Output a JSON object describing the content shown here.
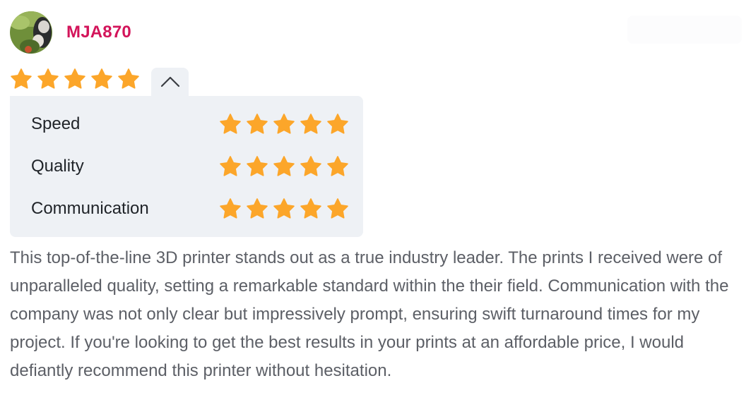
{
  "review": {
    "author": "MJA870",
    "rating": 5,
    "rating_max": 5,
    "breakdown": [
      {
        "label": "Speed",
        "rating": 5
      },
      {
        "label": "Quality",
        "rating": 5
      },
      {
        "label": "Communication",
        "rating": 5
      }
    ],
    "text": "This top-of-the-line 3D printer stands out as a true industry leader. The prints I received were of unparalleled quality, setting a remarkable standard within the their field. Communication with the company was not only clear but impressively prompt, ensuring swift turnaround times for my project. If you're looking to get the best results in your prints at an affordable price, I would defiantly recommend this printer without hesitation."
  },
  "icons": {
    "star": "star-icon",
    "toggle": "chevron-up-icon",
    "avatar": "avatar"
  },
  "colors": {
    "author_name": "#d3145a",
    "star": "#fca62a",
    "panel_bg": "#eef1f5",
    "body_text": "#5c5f66",
    "label_text": "#1f2328"
  }
}
